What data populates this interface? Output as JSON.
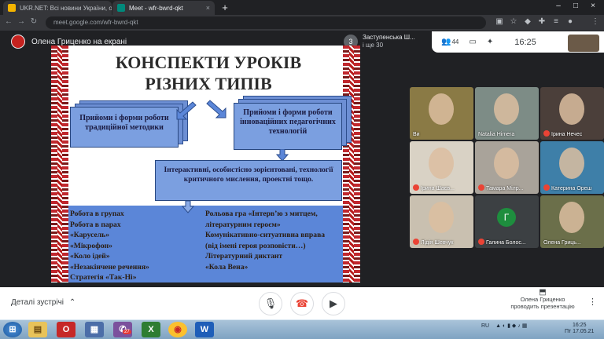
{
  "browser": {
    "tabs": [
      {
        "label": "UKR.NET: Всі новини України, ос",
        "close": "×"
      },
      {
        "label": "Meet - wfr-bwrd-qkt",
        "close": "×"
      }
    ],
    "new_tab": "+",
    "window_controls": [
      "–",
      "□",
      "×"
    ],
    "url": "meet.google.com/wfr-bwrd-qkt"
  },
  "meet": {
    "presenter_label": "Олена Гриценко на екрані",
    "people": {
      "count_badge": "3",
      "name": "Заступенська Ш...",
      "more": "і ще 30"
    },
    "participants_count": "44",
    "clock": "16:25"
  },
  "slide": {
    "title_line1": "КОНСПЕКТИ УРОКІВ",
    "title_line2": "РІЗНИХ ТИПІВ",
    "box_left": "Прийоми і форми роботи традиційної методики",
    "box_right": "Прийоми і форми роботи інноваційних педагогічних технологій",
    "box_mid": "Інтерактивні, особистісно зорієнтовані, технології критичного мислення, проектні тощо.",
    "list_left": [
      "Робота в групах",
      "Робота в парах",
      "«Карусель»",
      "«Мікрофон»",
      "«Коло ідей»",
      "«Незакінчене речення»",
      "Стратегія «Так-Ні»"
    ],
    "list_right": [
      "Рольова гра «Інтерв’ю з митцем,",
      "літературним героєм»",
      "Комунікативно-ситуативна вправа",
      "(від імені героя розповісти…)",
      "Літературний диктант",
      "«Кола Вена»"
    ]
  },
  "tiles": [
    {
      "name": "Ви",
      "muted": false,
      "bg": "#8a7a45"
    },
    {
      "name": "Natalia Himera",
      "muted": false,
      "bg": "#7d8c86"
    },
    {
      "name": "Ірина Нечес",
      "muted": true,
      "bg": "#4b3f3a"
    },
    {
      "name": "Ірина Шаєв...",
      "muted": true,
      "bg": "#d9d2c5"
    },
    {
      "name": "Тамара Мілр...",
      "muted": true,
      "bg": "#a9a39a"
    },
    {
      "name": "Катерина Ореш",
      "muted": true,
      "bg": "#3e7fa8"
    },
    {
      "name": "Лідія Шевчук",
      "muted": true,
      "bg": "#c9c0b0"
    },
    {
      "name": "Галина Болос...",
      "muted": true,
      "bg": "#3c4043",
      "initial": "Г"
    },
    {
      "name": "Олена Гриць...",
      "muted": false,
      "bg": "#6b6f4a"
    }
  ],
  "bottom": {
    "details": "Деталі зустрічі",
    "present_line1": "Олена Гриценко",
    "present_line2": "проводить презентацію"
  },
  "taskbar": {
    "lang": "RU",
    "time": "16:25",
    "date": "Пт 17.05.21",
    "viber_badge": "27"
  }
}
